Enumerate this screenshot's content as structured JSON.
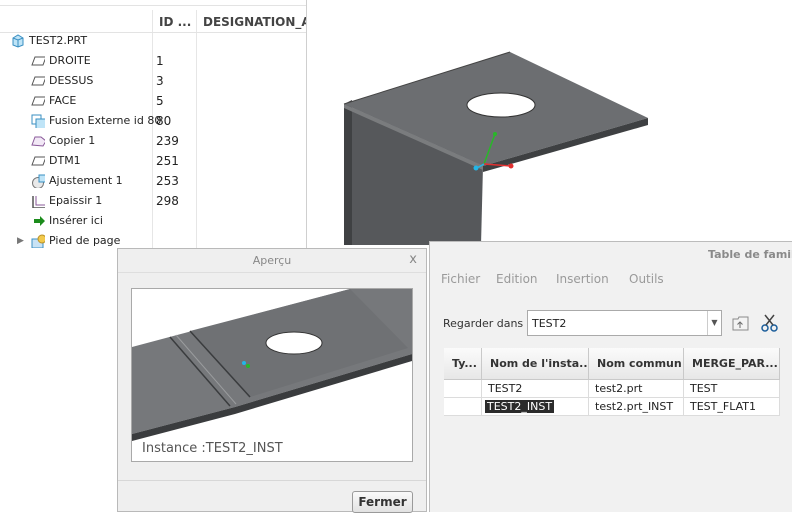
{
  "model_tree": {
    "columns": [
      "ID ...",
      "DESIGNATION_AI"
    ],
    "root": "TEST2.PRT",
    "items": [
      {
        "label": "DROITE",
        "id": "1",
        "icon": "datum-plane-icon"
      },
      {
        "label": "DESSUS",
        "id": "3",
        "icon": "datum-plane-icon"
      },
      {
        "label": "FACE",
        "id": "5",
        "icon": "datum-plane-icon"
      },
      {
        "label": "Fusion Externe id 80",
        "id": "80",
        "icon": "merge-icon"
      },
      {
        "label": "Copier 1",
        "id": "239",
        "icon": "copy-surface-icon"
      },
      {
        "label": "DTM1",
        "id": "251",
        "icon": "datum-plane-icon"
      },
      {
        "label": "Ajustement 1",
        "id": "253",
        "icon": "trim-icon"
      },
      {
        "label": "Epaissir 1",
        "id": "298",
        "icon": "thicken-icon"
      },
      {
        "label": "Insérer ici",
        "id": "",
        "icon": "insert-arrow-icon"
      },
      {
        "label": "Pied de page",
        "id": "",
        "icon": "footer-icon"
      }
    ]
  },
  "preview_dialog": {
    "title": "Aperçu",
    "close_glyph": "x",
    "caption": "Instance :TEST2_INST",
    "close_button": "Fermer"
  },
  "family_table": {
    "title": "Table de famill",
    "menu": [
      "Fichier",
      "Edition",
      "Insertion",
      "Outils"
    ],
    "look_in_label": "Regarder dans :",
    "look_in_value": "TEST2",
    "columns": [
      "Ty...",
      "Nom de l'insta...",
      "Nom commun",
      "MERGE_PAR..."
    ],
    "rows": [
      {
        "type": "",
        "instance": "TEST2",
        "common": "test2.prt",
        "merge": "TEST"
      },
      {
        "type": "",
        "instance": "TEST2_INST",
        "common": "test2.prt_INST",
        "merge": "TEST_FLAT1"
      }
    ]
  },
  "colors": {
    "model_top": "#6b6b6b",
    "model_side": "#505254",
    "axis_x": "#e23030",
    "axis_y": "#28b828",
    "axis_z": "#22b6e8"
  }
}
